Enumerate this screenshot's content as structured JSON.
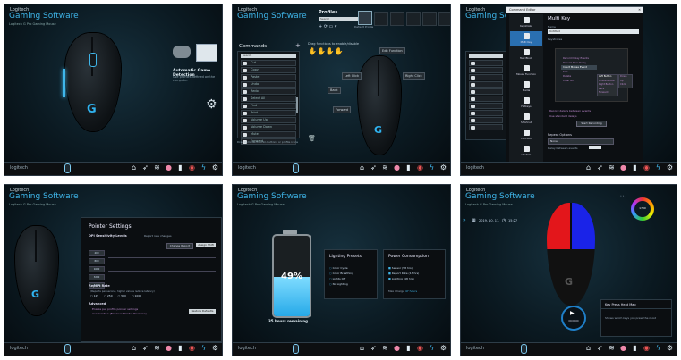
{
  "brand": {
    "company": "Logitech",
    "app": "Gaming Software",
    "subtitle": "Logitech G Pro Gaming Mouse"
  },
  "bottombar": {
    "logo": "logitech",
    "icons": [
      "home-icon",
      "pointer-icon",
      "sliders-icon",
      "color-icon",
      "battery-icon",
      "heatmap-icon",
      "g-icon",
      "gear-icon"
    ]
  },
  "panel1": {
    "auto_detect_title": "Automatic Game Detection",
    "auto_detect_desc": "Use profiles defined on the computer"
  },
  "panel2": {
    "profiles_title": "Profiles",
    "search_placeholder": "Search",
    "default_profile": "Default Profile",
    "commands_title": "Commands",
    "commands_search": "Search",
    "commands_footer": "Drag commands onto buttons or profile icons",
    "edit_button": "Edit Function",
    "command_items": [
      "Cut",
      "Copy",
      "Paste",
      "Undo",
      "Redo",
      "Select All",
      "Find",
      "Print",
      "Volume Up",
      "Volume Down",
      "Mute",
      "Forward"
    ],
    "labels": [
      "Left Click",
      "Right Click",
      "Back",
      "Forward",
      "DPI Shift"
    ]
  },
  "panel3": {
    "window_title": "Command Editor",
    "dialog_title": "Multi Key",
    "name_label": "Name",
    "name_value": "Untitled",
    "keystrokes_label": "Keystrokes",
    "sidebar_items": [
      "Keystroke",
      "Multi Key",
      "Text Block",
      "Mouse Function",
      "Media",
      "Hotkeys",
      "Shortcut",
      "Function",
      "Ventrilo"
    ],
    "menu_items": [
      "Record Delay Events",
      "Record After Delay",
      "Insert Mouse Event",
      "Edit",
      "Delete",
      "Clear All"
    ],
    "submenu": [
      "Left Button",
      "Middle Button",
      "Right Button",
      "Back",
      "Forward"
    ],
    "submenu2": [
      "Down",
      "Up",
      "Click"
    ],
    "check1": "Record delays between events",
    "check2": "Use standard delays",
    "stop_button": "Start Recording",
    "repeat_title": "Repeat Options",
    "repeat_value": "None",
    "delay_label": "Delay between events",
    "ok": "OK",
    "cancel": "Cancel",
    "help": "Help"
  },
  "panel4": {
    "title": "Pointer Settings",
    "dpi_label": "DPI Sensitivity Levels",
    "dpi_note": "Report rate changes",
    "shift_button": "Change Report",
    "report_button": "Assign Shift",
    "report_rate_title": "Report Rate",
    "report_rate_desc": "(Reports per second, higher values reduce latency)",
    "rates": [
      "125",
      "250",
      "500",
      "1000"
    ],
    "advanced_title": "Advanced",
    "adv1": "Enable per profile pointer settings",
    "adv2": "Acceleration (Enhance Pointer Precision)",
    "restore_button": "Restore Defaults",
    "dpi_rows": [
      "400",
      "800",
      "1600",
      "3200",
      "6400"
    ]
  },
  "panel5": {
    "battery_percent": 49,
    "battery_label": "49%",
    "remaining": "35 hours remaining",
    "lighting_title": "Lighting Presets",
    "lighting_items": [
      "Color Cycle",
      "Color Breathing",
      "Lights Off",
      "No Lighting"
    ],
    "power_title": "Power Consumption",
    "power_items": [
      "Sensor (58 hrs)",
      "Report Rate (13 hrs)",
      "Lighting (48 hrs)"
    ],
    "max_charge": "Max Charge",
    "max_charge_value": "47 hours"
  },
  "panel6": {
    "date": "2019. 10. 11.",
    "time": "15:27",
    "heatmap_title": "Key Press Heat Map",
    "heatmap_desc": "Shows which keys you press the most",
    "timer": "00:00:00",
    "ring_value": "1700"
  },
  "colors": {
    "accent": "#3fb6ea",
    "heat_red": "#e3161b",
    "heat_blue": "#1a23e8"
  }
}
